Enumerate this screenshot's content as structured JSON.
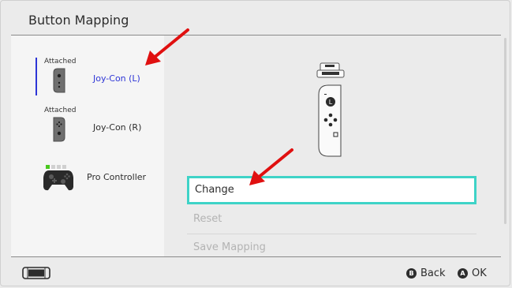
{
  "header": {
    "title": "Button Mapping"
  },
  "controllers": [
    {
      "status": "Attached",
      "name": "Joy-Con (L)"
    },
    {
      "status": "Attached",
      "name": "Joy-Con (R)"
    },
    {
      "status": "",
      "name": "Pro Controller"
    }
  ],
  "menu": {
    "change": "Change",
    "reset": "Reset",
    "save": "Save Mapping"
  },
  "joycon_preview": {
    "stick_label": "L"
  },
  "footer": {
    "back_key": "B",
    "back_label": "Back",
    "ok_key": "A",
    "ok_label": "OK"
  },
  "colors": {
    "accent": "#2d35d6",
    "focus_border": "#3ed3c7",
    "annotation_arrow": "#e01010",
    "player_led": "#49c81e"
  }
}
